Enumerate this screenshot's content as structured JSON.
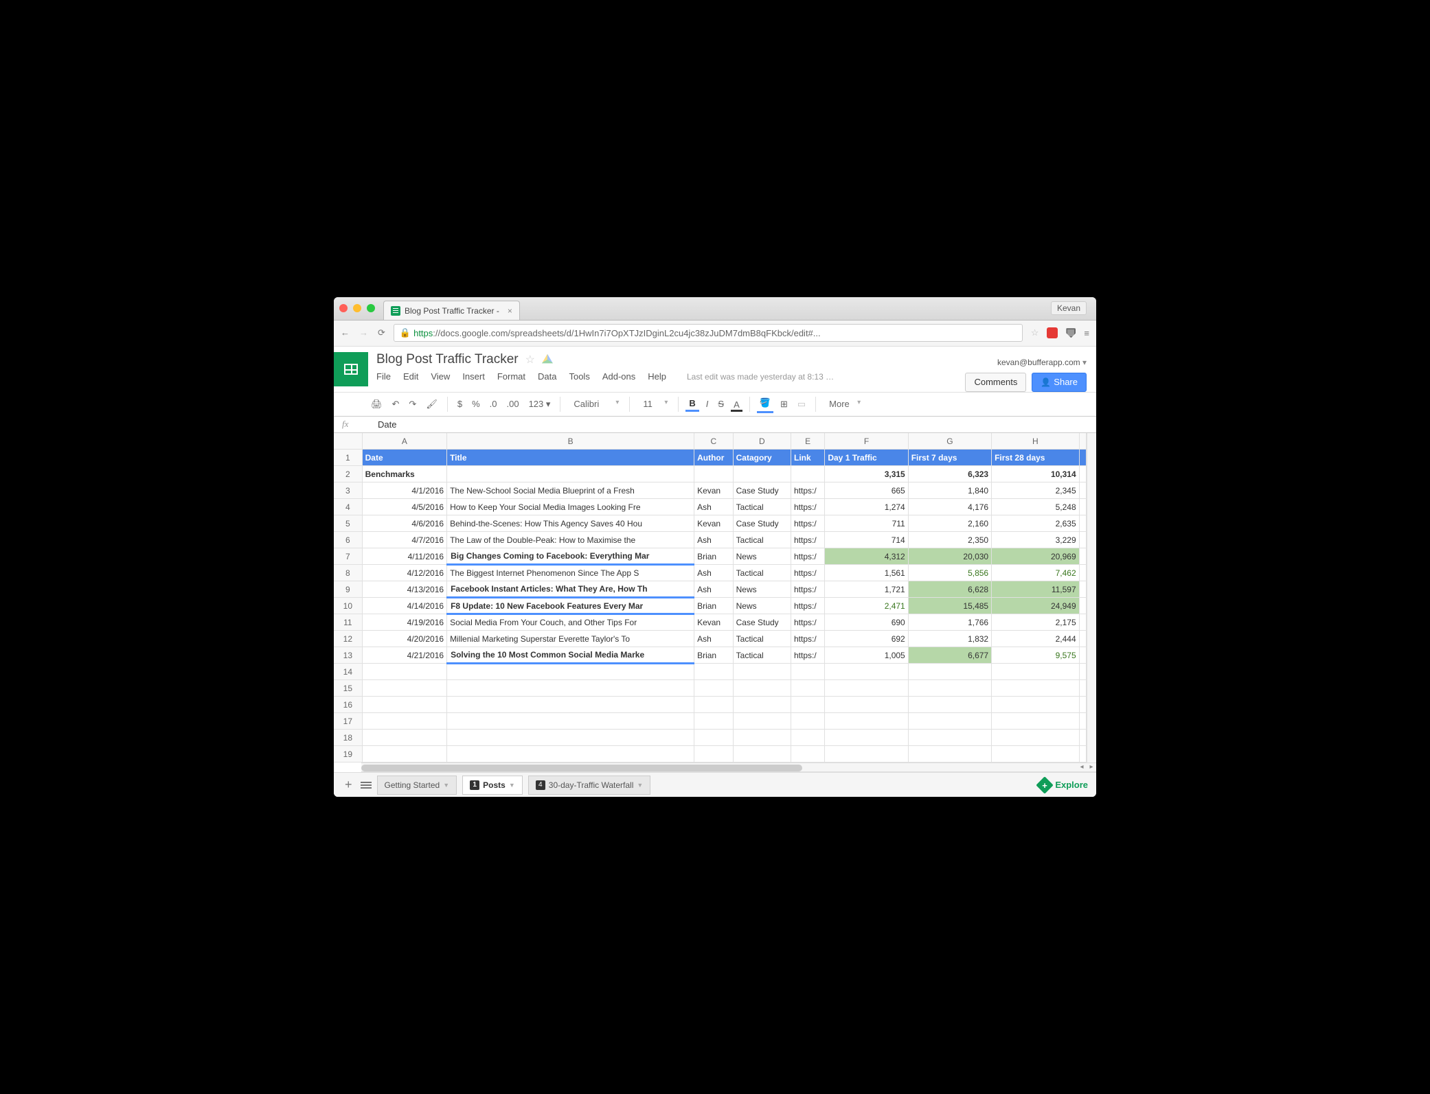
{
  "chrome": {
    "tab_title": "Blog Post Traffic Tracker - ",
    "user": "Kevan",
    "url_https": "https",
    "url_rest": "://docs.google.com/spreadsheets/d/1HwIn7i7OpXTJzIDginL2cu4jc38zJuDM7dmB8qFKbck/edit#..."
  },
  "doc": {
    "title": "Blog Post Traffic Tracker",
    "account": "kevan@bufferapp.com",
    "last_edit": "Last edit was made yesterday at 8:13 …",
    "comments_btn": "Comments",
    "share_btn": "Share"
  },
  "menu": [
    "File",
    "Edit",
    "View",
    "Insert",
    "Format",
    "Data",
    "Tools",
    "Add-ons",
    "Help"
  ],
  "toolbar": {
    "font": "Calibri",
    "size": "11",
    "more": "More"
  },
  "formula": {
    "value": "Date"
  },
  "columns": [
    "A",
    "B",
    "C",
    "D",
    "E",
    "F",
    "G",
    "H"
  ],
  "headers": {
    "A": "Date",
    "B": "Title",
    "C": "Author",
    "D": "Catagory",
    "E": "Link",
    "F": "Day 1 Traffic",
    "G": "First 7 days",
    "H": "First 28 days"
  },
  "benchmarks": {
    "label": "Benchmarks",
    "F": "3,315",
    "G": "6,323",
    "H": "10,314"
  },
  "rows": [
    {
      "n": 3,
      "date": "4/1/2016",
      "title": "The New-School Social Media Blueprint of a Fresh ",
      "author": "Kevan",
      "cat": "Case Study",
      "link": "https:/",
      "f": "665",
      "g": "1,840",
      "h": "2,345"
    },
    {
      "n": 4,
      "date": "4/5/2016",
      "title": "How to Keep Your Social Media Images Looking Fre",
      "author": "Ash",
      "cat": "Tactical",
      "link": "https:/",
      "f": "1,274",
      "g": "4,176",
      "h": "5,248"
    },
    {
      "n": 5,
      "date": "4/6/2016",
      "title": "Behind-the-Scenes: How This Agency Saves 40 Hou",
      "author": "Kevan",
      "cat": "Case Study",
      "link": "https:/",
      "f": "711",
      "g": "2,160",
      "h": "2,635"
    },
    {
      "n": 6,
      "date": "4/7/2016",
      "title": "The Law of the Double-Peak: How to Maximise the ",
      "author": "Ash",
      "cat": "Tactical",
      "link": "https:/",
      "f": "714",
      "g": "2,350",
      "h": "3,229"
    },
    {
      "n": 7,
      "date": "4/11/2016",
      "title": "Big Changes Coming to Facebook: Everything Mar",
      "author": "Brian",
      "cat": "News",
      "link": "https:/",
      "f": "4,312",
      "g": "20,030",
      "h": "20,969",
      "bold": true,
      "fc": "hl",
      "gc": "hl",
      "hc": "hl"
    },
    {
      "n": 8,
      "date": "4/12/2016",
      "title": "The Biggest Internet Phenomenon Since The App S",
      "author": "Ash",
      "cat": "Tactical",
      "link": "https:/",
      "f": "1,561",
      "g": "5,856",
      "h": "7,462",
      "gc": "green-txt",
      "hc": "green-txt"
    },
    {
      "n": 9,
      "date": "4/13/2016",
      "title": "Facebook Instant Articles: What They Are, How Th",
      "author": "Ash",
      "cat": "News",
      "link": "https:/",
      "f": "1,721",
      "g": "6,628",
      "h": "11,597",
      "bold": true,
      "gc": "hl",
      "hc": "hl"
    },
    {
      "n": 10,
      "date": "4/14/2016",
      "title": "F8 Update: 10 New Facebook Features Every Mar",
      "author": "Brian",
      "cat": "News",
      "link": "https:/",
      "f": "2,471",
      "g": "15,485",
      "h": "24,949",
      "bold": true,
      "fc": "green-txt",
      "gc": "hl",
      "hc": "hl"
    },
    {
      "n": 11,
      "date": "4/19/2016",
      "title": "Social Media From Your Couch, and Other Tips For",
      "author": "Kevan",
      "cat": "Case Study",
      "link": "https:/",
      "f": "690",
      "g": "1,766",
      "h": "2,175"
    },
    {
      "n": 12,
      "date": "4/20/2016",
      "title": "Millenial Marketing Superstar Everette Taylor's To",
      "author": "Ash",
      "cat": "Tactical",
      "link": "https:/",
      "f": "692",
      "g": "1,832",
      "h": "2,444"
    },
    {
      "n": 13,
      "date": "4/21/2016",
      "title": "Solving the 10 Most Common Social Media Marke",
      "author": "Brian",
      "cat": "Tactical",
      "link": "https:/",
      "f": "1,005",
      "g": "6,677",
      "h": "9,575",
      "bold": true,
      "gc": "hl",
      "hc": "green-txt"
    }
  ],
  "empty_rows": [
    14,
    15,
    16,
    17,
    18,
    19
  ],
  "sheets": {
    "s1": "Getting Started",
    "s2": "Posts",
    "s3": "30-day-Traffic Waterfall",
    "badge2": "1",
    "badge3": "4",
    "explore": "Explore"
  }
}
